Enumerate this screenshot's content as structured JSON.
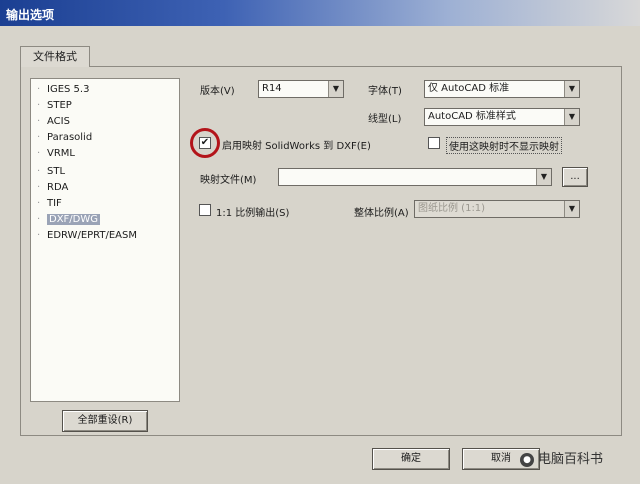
{
  "window": {
    "title": "输出选项"
  },
  "tab": {
    "label": "文件格式"
  },
  "file_formats": [
    {
      "label": "IGES 5.3"
    },
    {
      "label": "STEP"
    },
    {
      "label": "ACIS"
    },
    {
      "label": "Parasolid"
    },
    {
      "label": "VRML"
    },
    {
      "label": "STL"
    },
    {
      "label": "RDA"
    },
    {
      "label": "TIF"
    },
    {
      "label": "DXF/DWG",
      "selected": true
    },
    {
      "label": "EDRW/EPRT/EASM"
    }
  ],
  "version": {
    "label": "版本(V)",
    "value": "R14"
  },
  "font": {
    "label": "字体(T)",
    "value": "仅 AutoCAD 标准"
  },
  "linetype": {
    "label": "线型(L)",
    "value": "AutoCAD 标准样式"
  },
  "enable_mapping": {
    "label": "启用映射 SolidWorks 到 DXF(E)",
    "checked": true
  },
  "no_map_prompt": {
    "label": "使用这映射时不显示映射",
    "checked": false
  },
  "map_file": {
    "label": "映射文件(M)",
    "value": "",
    "browse_label": "..."
  },
  "scale_output": {
    "label": "1:1 比例输出(S)",
    "checked": false
  },
  "overall_scale": {
    "label": "整体比例(A)",
    "value": "图纸比例 (1:1)"
  },
  "buttons": {
    "all_reset": "全部重设(R)",
    "ok": "确定",
    "cancel": "取消"
  },
  "watermark": {
    "text": "电脑百科书"
  }
}
